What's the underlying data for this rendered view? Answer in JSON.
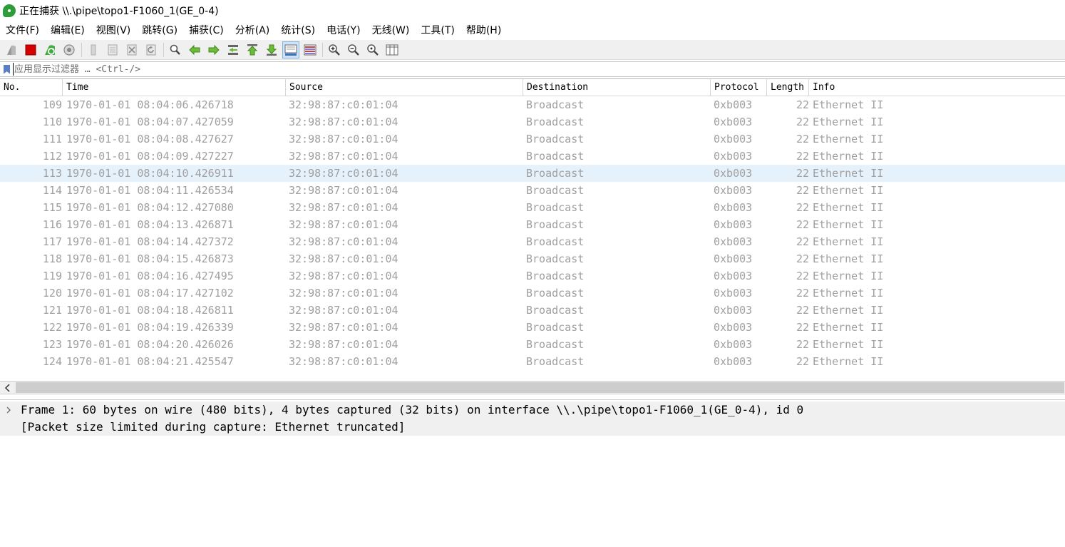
{
  "window": {
    "title": "正在捕获 \\\\.\\pipe\\topo1-F1060_1(GE_0-4)"
  },
  "menu": [
    "文件(F)",
    "编辑(E)",
    "视图(V)",
    "跳转(G)",
    "捕获(C)",
    "分析(A)",
    "统计(S)",
    "电话(Y)",
    "无线(W)",
    "工具(T)",
    "帮助(H)"
  ],
  "filter": {
    "placeholder": "应用显示过滤器 … <Ctrl-/>",
    "value": ""
  },
  "packet_list": {
    "columns": [
      "No.",
      "Time",
      "Source",
      "Destination",
      "Protocol",
      "Length",
      "Info"
    ],
    "selected_no": "113",
    "rows": [
      {
        "no": "109",
        "time": "1970-01-01 08:04:06.426718",
        "source": "32:98:87:c0:01:04",
        "destination": "Broadcast",
        "protocol": "0xb003",
        "length": "22",
        "info": "Ethernet II"
      },
      {
        "no": "110",
        "time": "1970-01-01 08:04:07.427059",
        "source": "32:98:87:c0:01:04",
        "destination": "Broadcast",
        "protocol": "0xb003",
        "length": "22",
        "info": "Ethernet II"
      },
      {
        "no": "111",
        "time": "1970-01-01 08:04:08.427627",
        "source": "32:98:87:c0:01:04",
        "destination": "Broadcast",
        "protocol": "0xb003",
        "length": "22",
        "info": "Ethernet II"
      },
      {
        "no": "112",
        "time": "1970-01-01 08:04:09.427227",
        "source": "32:98:87:c0:01:04",
        "destination": "Broadcast",
        "protocol": "0xb003",
        "length": "22",
        "info": "Ethernet II"
      },
      {
        "no": "113",
        "time": "1970-01-01 08:04:10.426911",
        "source": "32:98:87:c0:01:04",
        "destination": "Broadcast",
        "protocol": "0xb003",
        "length": "22",
        "info": "Ethernet II"
      },
      {
        "no": "114",
        "time": "1970-01-01 08:04:11.426534",
        "source": "32:98:87:c0:01:04",
        "destination": "Broadcast",
        "protocol": "0xb003",
        "length": "22",
        "info": "Ethernet II"
      },
      {
        "no": "115",
        "time": "1970-01-01 08:04:12.427080",
        "source": "32:98:87:c0:01:04",
        "destination": "Broadcast",
        "protocol": "0xb003",
        "length": "22",
        "info": "Ethernet II"
      },
      {
        "no": "116",
        "time": "1970-01-01 08:04:13.426871",
        "source": "32:98:87:c0:01:04",
        "destination": "Broadcast",
        "protocol": "0xb003",
        "length": "22",
        "info": "Ethernet II"
      },
      {
        "no": "117",
        "time": "1970-01-01 08:04:14.427372",
        "source": "32:98:87:c0:01:04",
        "destination": "Broadcast",
        "protocol": "0xb003",
        "length": "22",
        "info": "Ethernet II"
      },
      {
        "no": "118",
        "time": "1970-01-01 08:04:15.426873",
        "source": "32:98:87:c0:01:04",
        "destination": "Broadcast",
        "protocol": "0xb003",
        "length": "22",
        "info": "Ethernet II"
      },
      {
        "no": "119",
        "time": "1970-01-01 08:04:16.427495",
        "source": "32:98:87:c0:01:04",
        "destination": "Broadcast",
        "protocol": "0xb003",
        "length": "22",
        "info": "Ethernet II"
      },
      {
        "no": "120",
        "time": "1970-01-01 08:04:17.427102",
        "source": "32:98:87:c0:01:04",
        "destination": "Broadcast",
        "protocol": "0xb003",
        "length": "22",
        "info": "Ethernet II"
      },
      {
        "no": "121",
        "time": "1970-01-01 08:04:18.426811",
        "source": "32:98:87:c0:01:04",
        "destination": "Broadcast",
        "protocol": "0xb003",
        "length": "22",
        "info": "Ethernet II"
      },
      {
        "no": "122",
        "time": "1970-01-01 08:04:19.426339",
        "source": "32:98:87:c0:01:04",
        "destination": "Broadcast",
        "protocol": "0xb003",
        "length": "22",
        "info": "Ethernet II"
      },
      {
        "no": "123",
        "time": "1970-01-01 08:04:20.426026",
        "source": "32:98:87:c0:01:04",
        "destination": "Broadcast",
        "protocol": "0xb003",
        "length": "22",
        "info": "Ethernet II"
      },
      {
        "no": "124",
        "time": "1970-01-01 08:04:21.425547",
        "source": "32:98:87:c0:01:04",
        "destination": "Broadcast",
        "protocol": "0xb003",
        "length": "22",
        "info": "Ethernet II"
      }
    ]
  },
  "details": {
    "frame_line": "Frame 1: 60 bytes on wire (480 bits), 4 bytes captured (32 bits) on interface \\\\.\\pipe\\topo1-F1060_1(GE_0-4), id 0",
    "sub_line": "[Packet size limited during capture: Ethernet truncated]"
  },
  "toolbar": {
    "icons": [
      "start-capture-icon",
      "stop-capture-icon",
      "restart-capture-icon",
      "capture-options-icon",
      "open-file-icon",
      "save-file-icon",
      "close-file-icon",
      "reload-file-icon",
      "find-packet-icon",
      "go-back-icon",
      "go-forward-icon",
      "go-to-packet-icon",
      "first-packet-icon",
      "last-packet-icon",
      "auto-scroll-icon",
      "colorize-icon",
      "zoom-in-icon",
      "zoom-out-icon",
      "normal-size-icon",
      "resize-columns-icon"
    ],
    "active": [
      "auto-scroll-icon"
    ]
  },
  "colors": {
    "selected_row": "#e5f1fb",
    "row_text": "#a0a0a0",
    "stop_red": "#d40000",
    "start_green": "#2e9c3a"
  }
}
